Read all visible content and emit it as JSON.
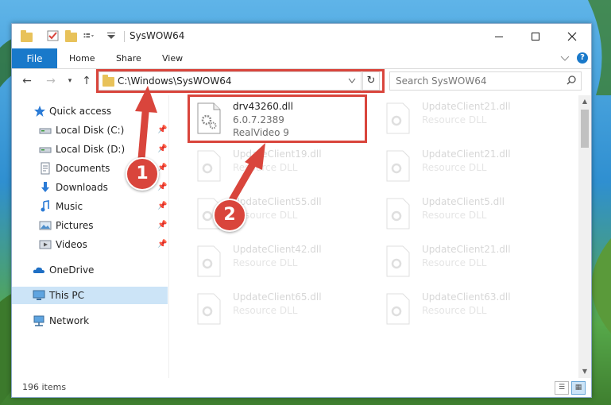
{
  "window": {
    "title": "SysWOW64",
    "controls": {
      "minimize": "—",
      "maximize": "☐",
      "close": "✕"
    }
  },
  "ribbon": {
    "tabs": [
      "File",
      "Home",
      "Share",
      "View"
    ],
    "expand_icon": "chevron-down-icon",
    "help_label": "?"
  },
  "navbar": {
    "address": "C:\\Windows\\SysWOW64",
    "search_placeholder": "Search SysWOW64"
  },
  "sidebar": {
    "quick_access": "Quick access",
    "items": [
      {
        "label": "Local Disk (C:)",
        "icon": "drive-icon",
        "pinned": true
      },
      {
        "label": "Local Disk (D:)",
        "icon": "drive-icon",
        "pinned": true
      },
      {
        "label": "Documents",
        "icon": "documents-icon",
        "pinned": true
      },
      {
        "label": "Downloads",
        "icon": "downloads-icon",
        "pinned": true
      },
      {
        "label": "Music",
        "icon": "music-icon",
        "pinned": true
      },
      {
        "label": "Pictures",
        "icon": "pictures-icon",
        "pinned": true
      },
      {
        "label": "Videos",
        "icon": "videos-icon",
        "pinned": true
      }
    ],
    "onedrive": "OneDrive",
    "this_pc": "This PC",
    "network": "Network"
  },
  "files": {
    "highlighted": {
      "name": "drv43260.dll",
      "version": "6.0.7.2389",
      "description": "RealVideo 9"
    },
    "faded": [
      {
        "name": "UpdateClient21.dll",
        "description": "Resource DLL"
      },
      {
        "name": "UpdateClient19.dll",
        "description": "Resource DLL"
      },
      {
        "name": "UpdateClient21.dll",
        "description": "Resource DLL"
      },
      {
        "name": "UpdateClient55.dll",
        "description": "Resource DLL"
      },
      {
        "name": "UpdateClient5.dll",
        "description": "Resource DLL"
      },
      {
        "name": "UpdateClient42.dll",
        "description": "Resource DLL"
      },
      {
        "name": "UpdateClient21.dll",
        "description": "Resource DLL"
      },
      {
        "name": "UpdateClient65.dll",
        "description": "Resource DLL"
      },
      {
        "name": "UpdateClient63.dll",
        "description": "Resource DLL"
      }
    ]
  },
  "status": {
    "item_count": "196 items"
  },
  "annotations": {
    "callout_1": "1",
    "callout_2": "2"
  },
  "colors": {
    "accent": "#1979ca",
    "highlight_box": "#d9453c",
    "selection": "#cce4f7"
  }
}
